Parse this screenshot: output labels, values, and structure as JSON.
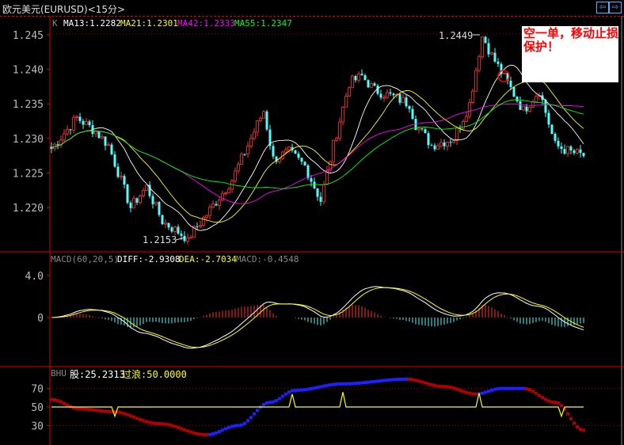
{
  "window": {
    "title": "欧元美元(EURUSD)<15分>",
    "nav_prev": "⇦",
    "nav_next": "⇨"
  },
  "main_panel": {
    "label": "K",
    "ma": [
      {
        "text": "MA13:1.2282",
        "period": 13,
        "color": "#ffffff"
      },
      {
        "text": "MA21:1.2301",
        "period": 21,
        "color": "#ffff00"
      },
      {
        "text": "MA42:1.2333",
        "period": 42,
        "color": "#ff00ff"
      },
      {
        "text": "MA55:1.2347",
        "period": 55,
        "color": "#00ff00"
      }
    ],
    "high_label": "1.2449",
    "low_label": "1.2153",
    "note": "空一单，移动止损保护！"
  },
  "macd_panel": {
    "label": "MACD(60,20,5)",
    "diff": "DIFF:-2.9308",
    "dea": "DEA:-2.7034",
    "macd": "MACD:-0.4548"
  },
  "bhu_panel": {
    "label": "BHU",
    "stock": "股:25.2313",
    "wave": "过浪:50.0000"
  },
  "chart_data": [
    {
      "type": "candlestick",
      "title": "EURUSD 15min",
      "bars": 169,
      "ylim": [
        1.2135,
        1.2475
      ],
      "yticks": [
        "1.245",
        "1.240",
        "1.235",
        "1.230",
        "1.225",
        "1.220"
      ],
      "close_path": [
        [
          0,
          1.2285
        ],
        [
          8,
          1.233
        ],
        [
          14,
          1.231
        ],
        [
          18,
          1.229
        ],
        [
          25,
          1.22
        ],
        [
          30,
          1.223
        ],
        [
          35,
          1.218
        ],
        [
          43,
          1.2155
        ],
        [
          49,
          1.219
        ],
        [
          57,
          1.224
        ],
        [
          62,
          1.229
        ],
        [
          67,
          1.234
        ],
        [
          70,
          1.227
        ],
        [
          75,
          1.228
        ],
        [
          80,
          1.226
        ],
        [
          85,
          1.221
        ],
        [
          89,
          1.229
        ],
        [
          94,
          1.238
        ],
        [
          98,
          1.239
        ],
        [
          102,
          1.237
        ],
        [
          108,
          1.236
        ],
        [
          113,
          1.235
        ],
        [
          115,
          1.232
        ],
        [
          120,
          1.229
        ],
        [
          127,
          1.23
        ],
        [
          132,
          1.235
        ],
        [
          134,
          1.24
        ],
        [
          136,
          1.2449
        ],
        [
          139,
          1.242
        ],
        [
          144,
          1.238
        ],
        [
          149,
          1.234
        ],
        [
          154,
          1.237
        ],
        [
          159,
          1.229
        ],
        [
          164,
          1.228
        ],
        [
          168,
          1.2275
        ]
      ],
      "up_color": "#ff3232",
      "down_color": "#54fcfc"
    },
    {
      "type": "line",
      "title": "MACD(60,20,5)",
      "ylim": [
        -4.5,
        5.2
      ],
      "yticks": [
        "4.0",
        "0"
      ],
      "series": [
        {
          "name": "DIFF",
          "color": "#ffffff"
        },
        {
          "name": "DEA",
          "color": "#ffff00"
        }
      ],
      "hist_colors": {
        "pos": "#ff3232",
        "neg": "#54fcfc"
      }
    },
    {
      "type": "line",
      "title": "BHU",
      "ylim": [
        12,
        90
      ],
      "yticks": [
        "70",
        "50",
        "30"
      ],
      "series": [
        {
          "name": "股",
          "points": [
            [
              0,
              58
            ],
            [
              9,
              48
            ],
            [
              19,
              45
            ],
            [
              34,
              32
            ],
            [
              49,
              20
            ],
            [
              59,
              30
            ],
            [
              69,
              55
            ],
            [
              77,
              68
            ],
            [
              92,
              75
            ],
            [
              112,
              80
            ],
            [
              124,
              72
            ],
            [
              134,
              64
            ],
            [
              142,
              70
            ],
            [
              149,
              70
            ],
            [
              159,
              55
            ],
            [
              168,
              25
            ]
          ],
          "up_color": "#2020ff",
          "down_color": "#b00000"
        },
        {
          "name": "过浪",
          "color": "#ffff00",
          "base": 50,
          "spikes": [
            [
              20,
              40
            ],
            [
              76,
              64
            ],
            [
              92,
              66
            ],
            [
              135,
              65
            ],
            [
              161,
              40
            ]
          ]
        }
      ]
    }
  ]
}
